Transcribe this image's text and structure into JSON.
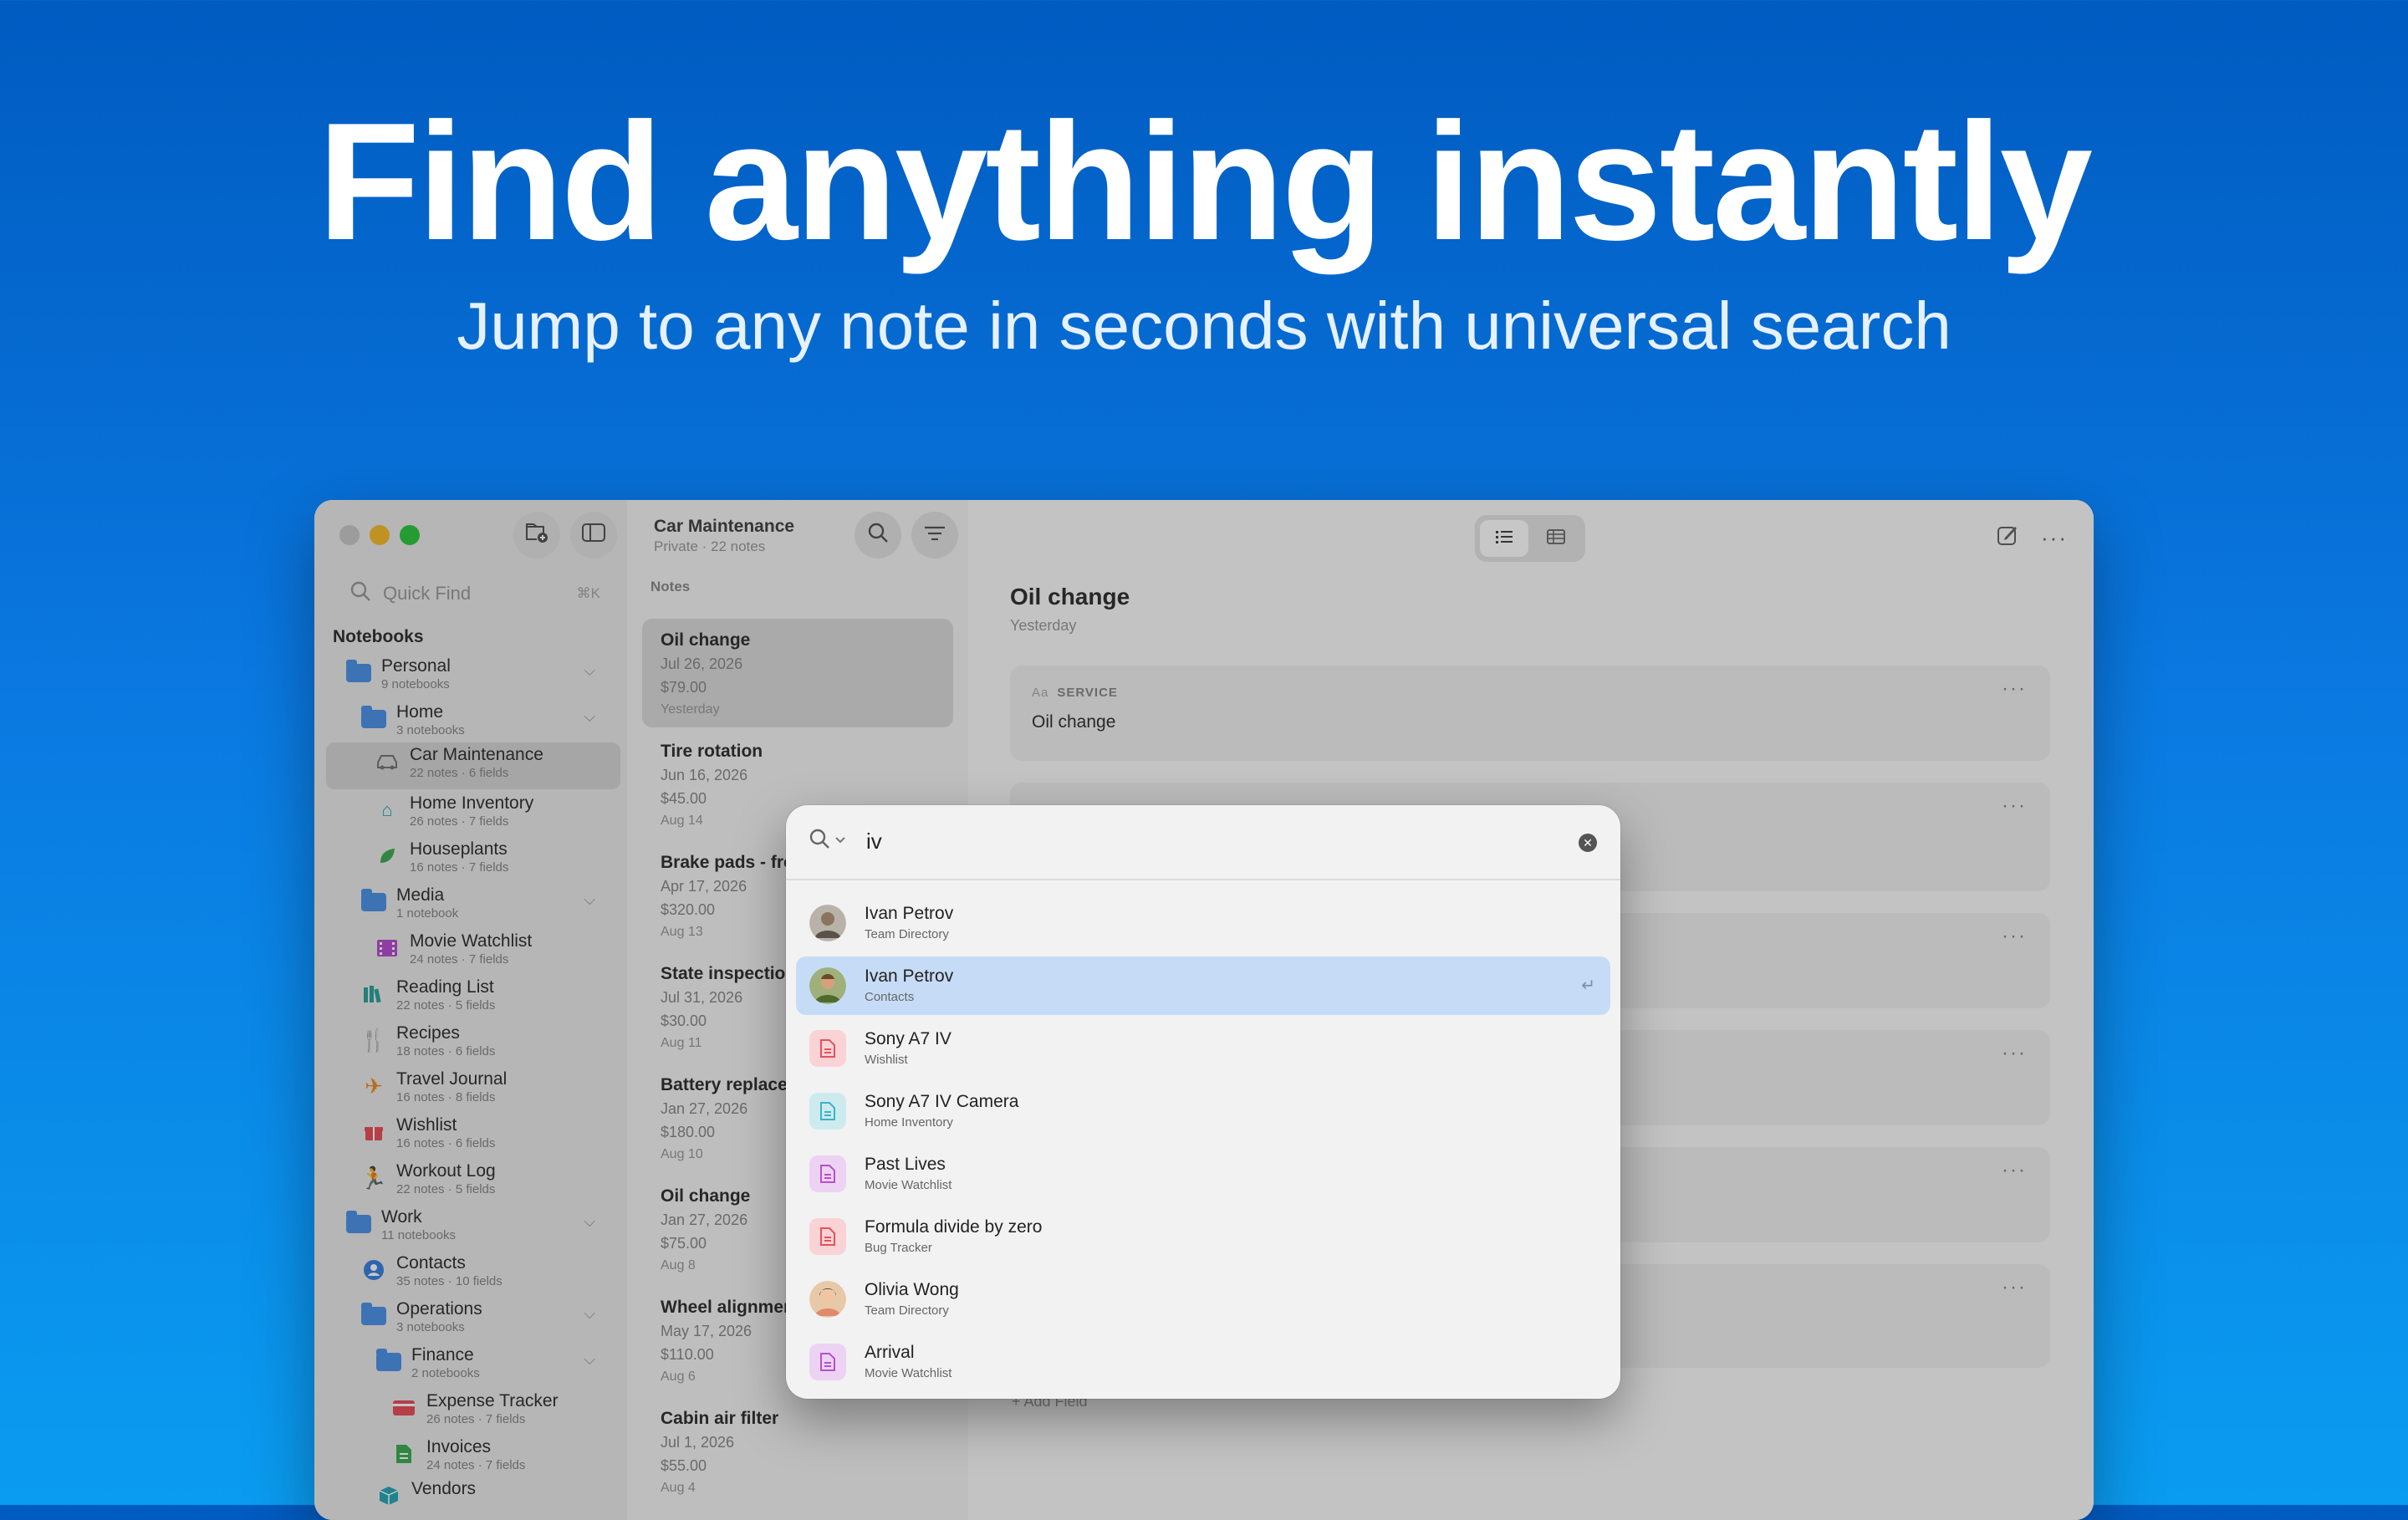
{
  "hero": {
    "title": "Find anything instantly",
    "subtitle": "Jump to any note in seconds with universal search"
  },
  "sidebar": {
    "quick_find_label": "Quick Find",
    "quick_find_shortcut": "⌘K",
    "section_label": "Notebooks",
    "items": [
      {
        "title": "Personal",
        "sub": "9 notebooks"
      },
      {
        "title": "Home",
        "sub": "3 notebooks"
      },
      {
        "title": "Car Maintenance",
        "sub": "22 notes · 6 fields"
      },
      {
        "title": "Home Inventory",
        "sub": "26 notes · 7 fields"
      },
      {
        "title": "Houseplants",
        "sub": "16 notes · 7 fields"
      },
      {
        "title": "Media",
        "sub": "1 notebook"
      },
      {
        "title": "Movie Watchlist",
        "sub": "24 notes · 7 fields"
      },
      {
        "title": "Reading List",
        "sub": "22 notes · 5 fields"
      },
      {
        "title": "Recipes",
        "sub": "18 notes · 6 fields"
      },
      {
        "title": "Travel Journal",
        "sub": "16 notes · 8 fields"
      },
      {
        "title": "Wishlist",
        "sub": "16 notes · 6 fields"
      },
      {
        "title": "Workout Log",
        "sub": "22 notes · 5 fields"
      },
      {
        "title": "Work",
        "sub": "11 notebooks"
      },
      {
        "title": "Contacts",
        "sub": "35 notes · 10 fields"
      },
      {
        "title": "Operations",
        "sub": "3 notebooks"
      },
      {
        "title": "Finance",
        "sub": "2 notebooks"
      },
      {
        "title": "Expense Tracker",
        "sub": "26 notes · 7 fields"
      },
      {
        "title": "Invoices",
        "sub": "24 notes · 7 fields"
      },
      {
        "title": "Vendors",
        "sub": ""
      }
    ]
  },
  "list": {
    "title": "Car Maintenance",
    "subtitle": "Private · 22 notes",
    "section_label": "Notes",
    "notes": [
      {
        "title": "Oil change",
        "date": "Jul 26, 2026",
        "amount": "$79.00",
        "updated": "Yesterday"
      },
      {
        "title": "Tire rotation",
        "date": "Jun 16, 2026",
        "amount": "$45.00",
        "updated": "Aug 14"
      },
      {
        "title": "Brake pads - fro",
        "date": "Apr 17, 2026",
        "amount": "$320.00",
        "updated": "Aug 13"
      },
      {
        "title": "State inspection",
        "date": "Jul 31, 2026",
        "amount": "$30.00",
        "updated": "Aug 11"
      },
      {
        "title": "Battery replacer",
        "date": "Jan 27, 2026",
        "amount": "$180.00",
        "updated": "Aug 10"
      },
      {
        "title": "Oil change",
        "date": "Jan 27, 2026",
        "amount": "$75.00",
        "updated": "Aug 8"
      },
      {
        "title": "Wheel alignmen",
        "date": "May 17, 2026",
        "amount": "$110.00",
        "updated": "Aug 6"
      },
      {
        "title": "Cabin air filter",
        "date": "Jul 1, 2026",
        "amount": "$55.00",
        "updated": "Aug 4"
      }
    ]
  },
  "detail": {
    "title": "Oil change",
    "date": "Yesterday",
    "field_label": "SERVICE",
    "field_prefix": "Aa",
    "field_value": "Oil change",
    "add_field": "+ Add Field"
  },
  "search": {
    "query": "iv",
    "results": [
      {
        "title": "Ivan Petrov",
        "sub": "Team Directory",
        "icon": "avatar-photo"
      },
      {
        "title": "Ivan Petrov",
        "sub": "Contacts",
        "icon": "avatar-photo"
      },
      {
        "title": "Sony A7 IV",
        "sub": "Wishlist",
        "icon": "document-icon"
      },
      {
        "title": "Sony A7 IV Camera",
        "sub": "Home Inventory",
        "icon": "document-icon"
      },
      {
        "title": "Past Lives",
        "sub": "Movie Watchlist",
        "icon": "document-icon"
      },
      {
        "title": "Formula divide by zero",
        "sub": "Bug Tracker",
        "icon": "document-icon"
      },
      {
        "title": "Olivia Wong",
        "sub": "Team Directory",
        "icon": "avatar-photo"
      },
      {
        "title": "Arrival",
        "sub": "Movie Watchlist",
        "icon": "document-icon"
      }
    ],
    "return_glyph": "↵"
  },
  "colors": {
    "accent": "#0a78e0",
    "selection": "#c6dcf6",
    "folder": "#4f92e8",
    "doc_red": "#e8505b",
    "doc_teal": "#3ab3c4",
    "doc_purple": "#b74fd0"
  }
}
